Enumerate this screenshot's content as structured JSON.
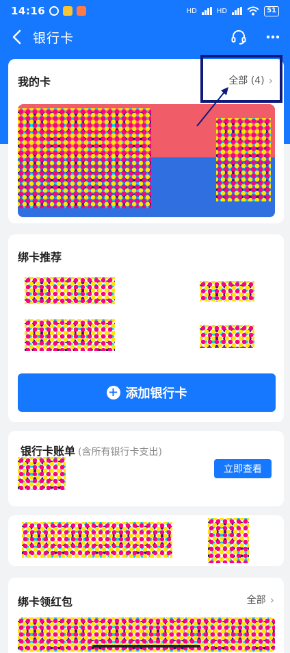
{
  "status_bar": {
    "time": "14:16",
    "network_1": "HD",
    "network_2": "HD",
    "battery": "51"
  },
  "nav": {
    "title": "银行卡"
  },
  "my_cards": {
    "title": "我的卡",
    "all_label": "全部 (4)"
  },
  "bind_recommend": {
    "title": "绑卡推荐",
    "add_button": "添加银行卡"
  },
  "card_bill": {
    "title": "银行卡账单",
    "subtitle": "(含所有银行卡支出)",
    "view_button": "立即查看"
  },
  "bind_red_packet": {
    "title": "绑卡领红包",
    "all_label": "全部"
  },
  "colors": {
    "brand_blue": "#1677ff",
    "page_bg": "#f2f3f5",
    "annotation_box": "#0d1a7a"
  }
}
